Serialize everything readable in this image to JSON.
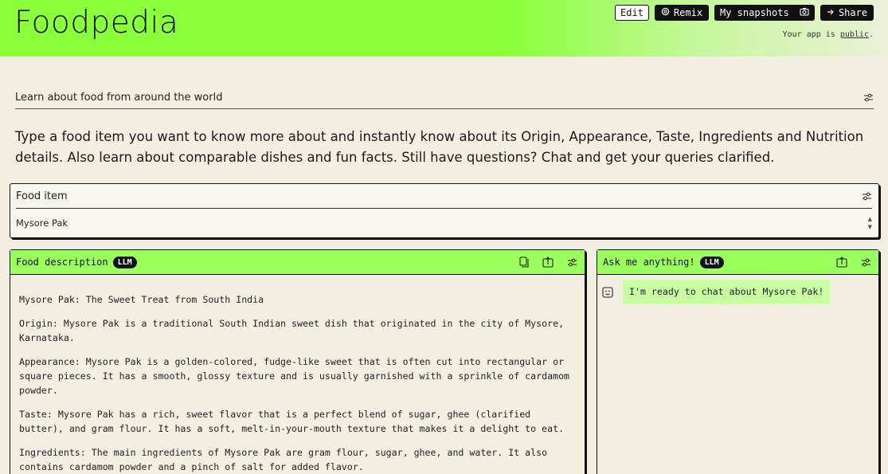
{
  "header": {
    "app_title": "Foodpedia",
    "edit_label": "Edit",
    "remix_label": "Remix",
    "snapshots_label": "My snapshots",
    "share_label": "Share",
    "public_prefix": "Your app is ",
    "public_link": "public",
    "public_suffix": "."
  },
  "subtitle": {
    "text": "Learn about food from around the world"
  },
  "description": "Type a food item you want to know more about and instantly know about its Origin, Appearance, Taste, Ingredients and Nutrition details. Also learn about comparable dishes and fun facts. Still have questions? Chat and get your queries clarified.",
  "food_input": {
    "label": "Food item",
    "value": "Mysore Pak"
  },
  "food_description": {
    "title": "Food description",
    "badge": "LLM",
    "paragraphs": [
      "Mysore Pak: The Sweet Treat from South India",
      "Origin: Mysore Pak is a traditional South Indian sweet dish that originated in the city of Mysore, Karnataka.",
      "Appearance: Mysore Pak is a golden-colored, fudge-like sweet that is often cut into rectangular or square pieces. It has a smooth, glossy texture and is usually garnished with a sprinkle of cardamom powder.",
      "Taste: Mysore Pak has a rich, sweet flavor that is a perfect blend of sugar, ghee (clarified butter), and gram flour. It has a soft, melt-in-your-mouth texture that makes it a delight to eat.",
      "Ingredients: The main ingredients of Mysore Pak are gram flour, sugar, ghee, and water. It also contains cardamom powder and a pinch of salt for added flavor."
    ]
  },
  "chat": {
    "title": "Ask me anything!",
    "badge": "LLM",
    "message": "I'm ready to chat about Mysore Pak!"
  },
  "colors": {
    "header_green": "#8aff3c",
    "panel_head_green": "#9bff5e",
    "bubble_green": "#c8ffa2",
    "background": "#f2efe2"
  },
  "icons": [
    "camera-icon",
    "share-arrow-icon",
    "remix-icon",
    "tune-icon",
    "copy-icon",
    "export-icon",
    "bot-icon"
  ]
}
